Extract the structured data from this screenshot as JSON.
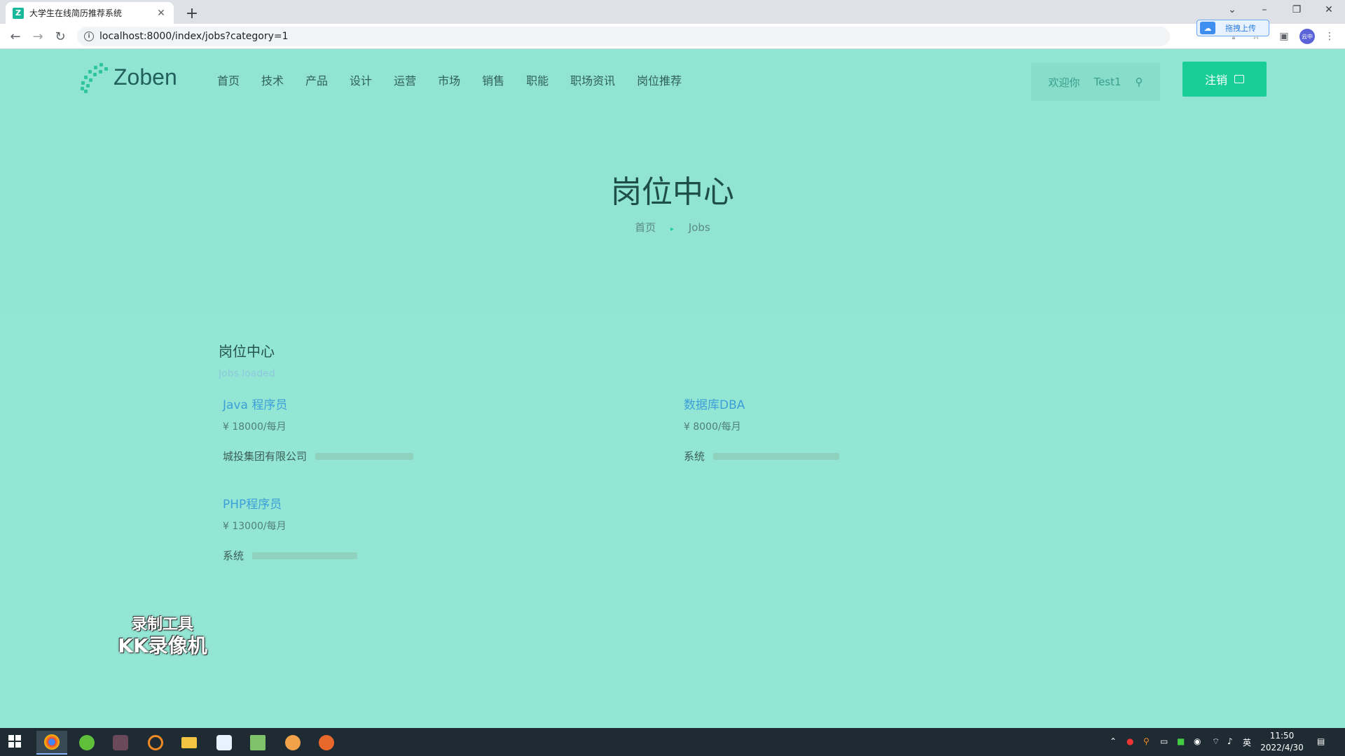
{
  "browser": {
    "tab_title": "大学生在线简历推荐系统",
    "favicon_letter": "Z",
    "url": "localhost:8000/index/jobs?category=1",
    "extension_label": "拖拽上传",
    "profile_label": "云中"
  },
  "header": {
    "logo_text": "Zoben",
    "nav": [
      "首页",
      "技术",
      "产品",
      "设计",
      "运营",
      "市场",
      "销售",
      "职能",
      "职场资讯",
      "岗位推荐"
    ],
    "welcome": "欢迎你",
    "username": "Test1",
    "logout_label": "注销"
  },
  "hero": {
    "title": "岗位中心",
    "breadcrumb_home": "首页",
    "breadcrumb_current": "Jobs"
  },
  "section": {
    "title": "岗位中心",
    "subtitle": "Jobs loaded"
  },
  "jobs": [
    {
      "title": "Java 程序员",
      "salary": "¥ 18000/每月",
      "company": "城投集团有限公司"
    },
    {
      "title": "数据库DBA",
      "salary": "¥ 8000/每月",
      "company": "系统"
    },
    {
      "title": "PHP程序员",
      "salary": "¥ 13000/每月",
      "company": "系统"
    }
  ],
  "watermark": {
    "line1": "录制工具",
    "line2": "KK录像机"
  },
  "taskbar": {
    "time": "11:50",
    "date": "2022/4/30",
    "ime": "英"
  },
  "colors": {
    "accent": "#19cf97",
    "page_bg": "#91e3d2",
    "job_title": "#3d9fd8"
  }
}
